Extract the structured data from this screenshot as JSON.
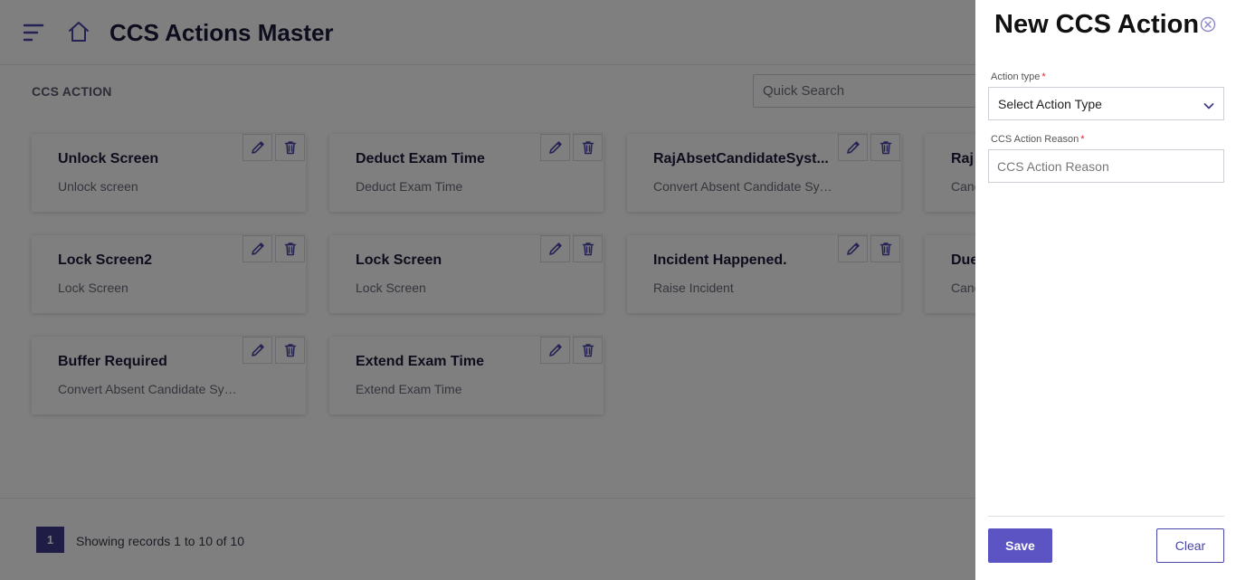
{
  "header": {
    "title": "CCS Actions Master"
  },
  "section": {
    "label": "CCS ACTION"
  },
  "search": {
    "placeholder": "Quick Search"
  },
  "cards": [
    {
      "title": "Unlock Screen",
      "subtitle": "Unlock screen"
    },
    {
      "title": "Deduct Exam Time",
      "subtitle": "Deduct Exam Time"
    },
    {
      "title": "RajAbsetCandidateSyst...",
      "subtitle": "Convert Absent Candidate Syst..."
    },
    {
      "title": "Raj",
      "subtitle": "Canc"
    },
    {
      "title": "Lock Screen2",
      "subtitle": "Lock Screen"
    },
    {
      "title": "Lock Screen",
      "subtitle": "Lock Screen"
    },
    {
      "title": "Incident Happened.",
      "subtitle": "Raise Incident"
    },
    {
      "title": "Due",
      "subtitle": "Canc"
    },
    {
      "title": "Buffer Required",
      "subtitle": "Convert Absent Candidate Syst..."
    },
    {
      "title": "Extend Exam Time",
      "subtitle": "Extend Exam Time"
    }
  ],
  "pagination": {
    "current_page": "1",
    "records_text": "Showing records 1 to 10 of 10"
  },
  "panel": {
    "title": "New CCS Action",
    "action_type_label": "Action type",
    "action_type_value": "Select Action Type",
    "reason_label": "CCS Action Reason",
    "reason_placeholder": "CCS Action Reason",
    "required_marker": "*",
    "save_label": "Save",
    "clear_label": "Clear"
  },
  "colors": {
    "accent": "#5b54c2",
    "pager": "#3f3b8a",
    "required": "#e0212c"
  },
  "icons": [
    "menu-icon",
    "home-icon",
    "pencil-icon",
    "trash-icon",
    "close-circle-icon",
    "chevron-down-icon"
  ]
}
